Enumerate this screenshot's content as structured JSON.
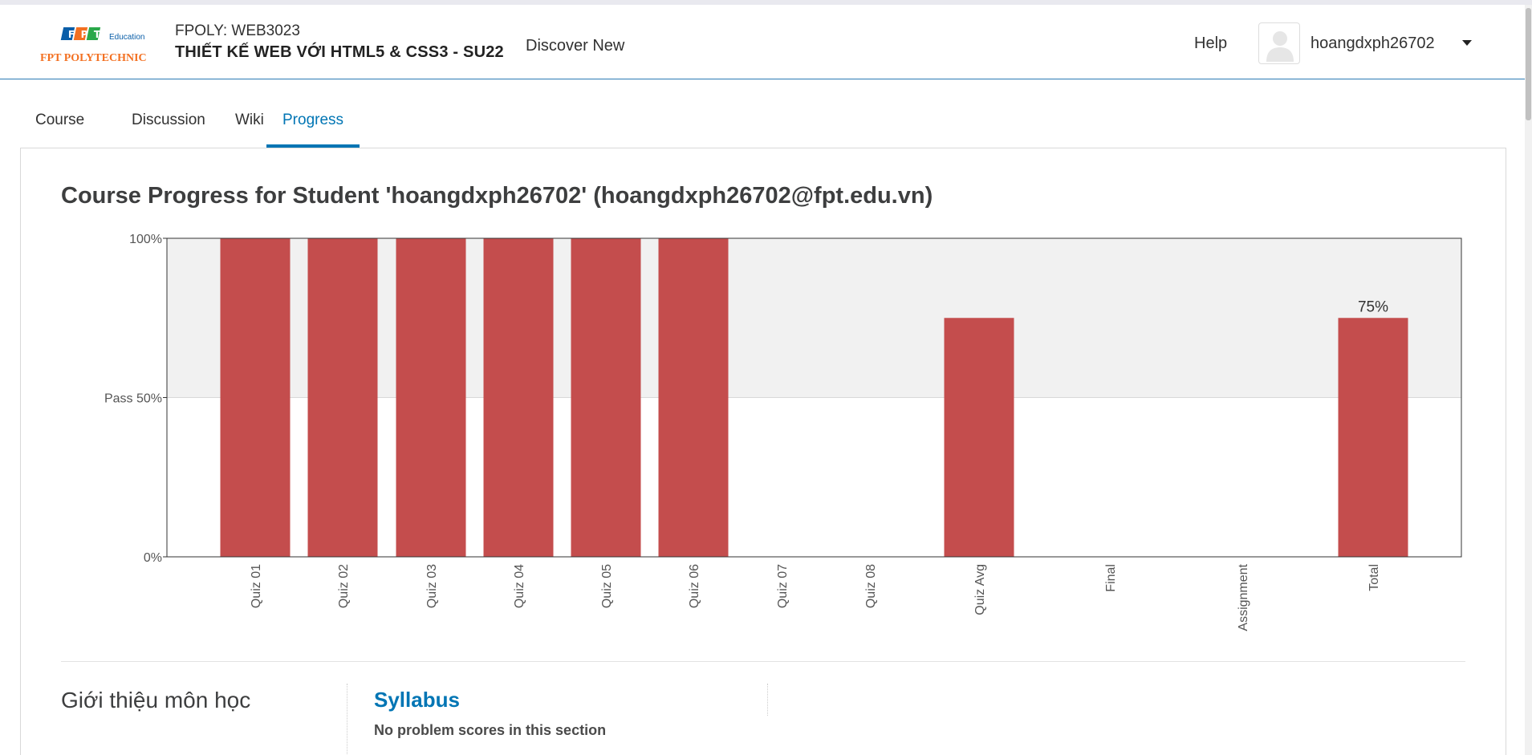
{
  "header": {
    "logo_brand": "FPT Education",
    "logo_name": "FPT POLYTECHNIC",
    "course_org": "FPOLY: WEB3023",
    "course_title": "THIẾT KẾ WEB VỚI HTML5 & CSS3 - SU22",
    "discover_label": "Discover New",
    "help_label": "Help",
    "username": "hoangdxph26702"
  },
  "tabs": [
    {
      "label": "Course",
      "active": false
    },
    {
      "label": "Discussion",
      "active": false
    },
    {
      "label": "Wiki",
      "active": false
    },
    {
      "label": "Progress",
      "active": true
    }
  ],
  "main": {
    "title": "Course Progress for Student 'hoangdxph26702' (hoangdxph26702@fpt.edu.vn)"
  },
  "chart_data": {
    "type": "bar",
    "categories": [
      "Quiz 01",
      "Quiz 02",
      "Quiz 03",
      "Quiz 04",
      "Quiz 05",
      "Quiz 06",
      "Quiz 07",
      "Quiz 08",
      "Quiz Avg",
      "Final",
      "Assignment",
      "Total"
    ],
    "values": [
      100,
      100,
      100,
      100,
      100,
      100,
      0,
      0,
      75,
      0,
      0,
      75
    ],
    "data_labels": {
      "Total": "75%"
    },
    "y_ticks": [
      {
        "value": 0,
        "label": "0%"
      },
      {
        "value": 50,
        "label": "Pass 50%"
      },
      {
        "value": 100,
        "label": "100%"
      }
    ],
    "ylim": [
      0,
      100
    ],
    "pass_threshold": 50,
    "bar_color": "#c44d4d",
    "pass_region_color": "#f1f1f1",
    "title": "",
    "xlabel": "",
    "ylabel": "",
    "grid": false
  },
  "section": {
    "title": "Giới thiệu môn học",
    "subsection_title": "Syllabus",
    "subsection_note": "No problem scores in this section"
  },
  "colors": {
    "accent": "#0075b4",
    "header_border": "#2a7ab5",
    "logo_orange": "#f37021"
  }
}
